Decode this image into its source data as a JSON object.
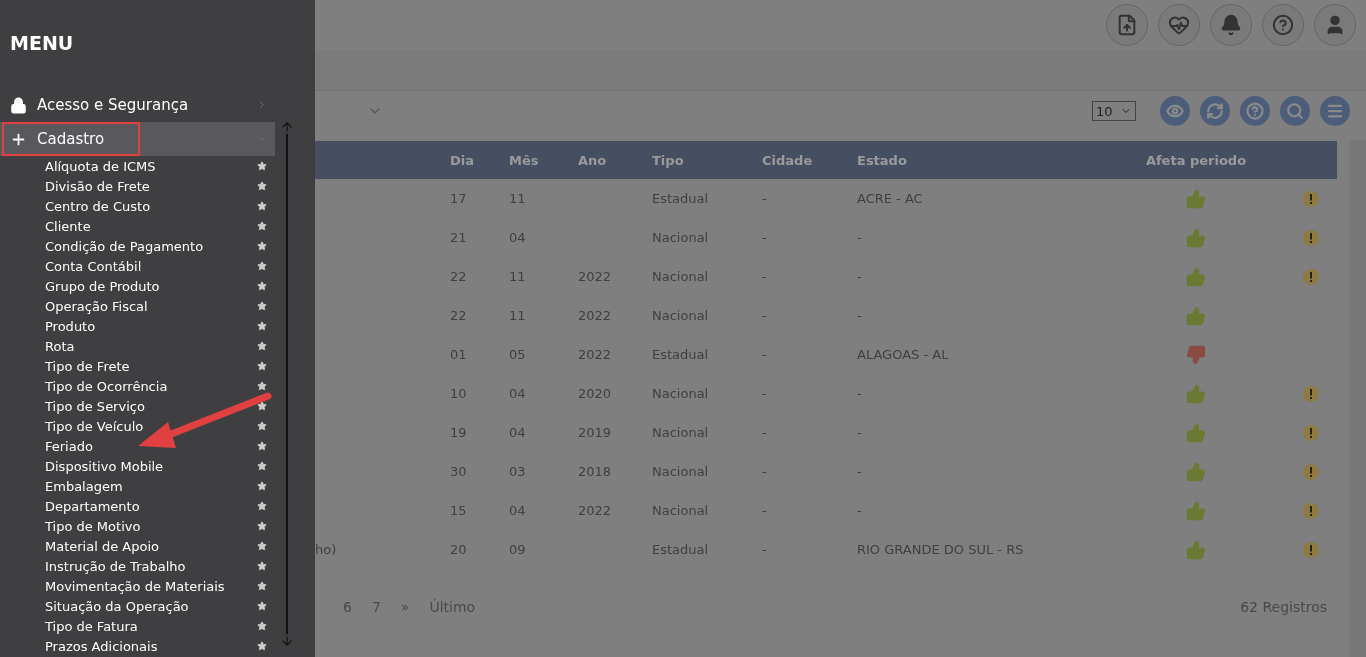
{
  "menu": {
    "title": "MENU",
    "sections": [
      {
        "label": "Acesso e Segurança",
        "kind": "lock",
        "expanded": false,
        "selected": false
      },
      {
        "label": "Cadastro",
        "kind": "plus",
        "expanded": true,
        "selected": true,
        "children": [
          {
            "label": "Alíquota de ICMS"
          },
          {
            "label": "Divisão de Frete"
          },
          {
            "label": "Centro de Custo"
          },
          {
            "label": "Cliente"
          },
          {
            "label": "Condição de Pagamento"
          },
          {
            "label": "Conta Contábil"
          },
          {
            "label": "Grupo de Produto"
          },
          {
            "label": "Operação Fiscal"
          },
          {
            "label": "Produto"
          },
          {
            "label": "Rota"
          },
          {
            "label": "Tipo de Frete"
          },
          {
            "label": "Tipo de Ocorrência"
          },
          {
            "label": "Tipo de Serviço"
          },
          {
            "label": "Tipo de Veículo"
          },
          {
            "label": "Feriado"
          },
          {
            "label": "Dispositivo Mobile"
          },
          {
            "label": "Embalagem"
          },
          {
            "label": "Departamento"
          },
          {
            "label": "Tipo de Motivo"
          },
          {
            "label": "Material de Apoio"
          },
          {
            "label": "Instrução de Trabalho"
          },
          {
            "label": "Movimentação de Materiais"
          },
          {
            "label": "Situação da Operação"
          },
          {
            "label": "Tipo de Fatura"
          },
          {
            "label": "Prazos Adicionais"
          }
        ]
      }
    ]
  },
  "top_bar": {
    "icons": [
      {
        "kind": "upload"
      },
      {
        "kind": "health"
      },
      {
        "kind": "bell"
      },
      {
        "kind": "help"
      },
      {
        "kind": "user"
      }
    ]
  },
  "toolbar": {
    "page_size": "10",
    "buttons": [
      {
        "kind": "view"
      },
      {
        "kind": "refresh"
      },
      {
        "kind": "help"
      },
      {
        "kind": "search"
      },
      {
        "kind": "menu"
      }
    ]
  },
  "table": {
    "columns": [
      "Dia",
      "Mês",
      "Ano",
      "Tipo",
      "Cidade",
      "Estado",
      "Afeta periodo"
    ],
    "rows": [
      {
        "dia": "17",
        "mes": "11",
        "tipo": "Estadual",
        "cidade": "-",
        "estado": "ACRE - AC",
        "affects": true,
        "warning": true
      },
      {
        "dia": "21",
        "mes": "04",
        "tipo": "Nacional",
        "cidade": "-",
        "estado": "-",
        "affects": true,
        "warning": true
      },
      {
        "dia": "22",
        "mes": "11",
        "ano": "2022",
        "tipo": "Nacional",
        "cidade": "-",
        "estado": "-",
        "affects": true,
        "warning": true
      },
      {
        "dia": "22",
        "mes": "11",
        "ano": "2022",
        "tipo": "Nacional",
        "cidade": "-",
        "estado": "-",
        "affects": true,
        "warning": false
      },
      {
        "dia": "01",
        "mes": "05",
        "ano": "2022",
        "tipo": "Estadual",
        "cidade": "-",
        "estado": "ALAGOAS - AL",
        "affects": false,
        "warning": false
      },
      {
        "dia": "10",
        "mes": "04",
        "ano": "2020",
        "tipo": "Nacional",
        "cidade": "-",
        "estado": "-",
        "affects": true,
        "warning": true
      },
      {
        "dia": "19",
        "mes": "04",
        "ano": "2019",
        "tipo": "Nacional",
        "cidade": "-",
        "estado": "-",
        "affects": true,
        "warning": true
      },
      {
        "dia": "30",
        "mes": "03",
        "ano": "2018",
        "tipo": "Nacional",
        "cidade": "-",
        "estado": "-",
        "affects": true,
        "warning": true
      },
      {
        "dia": "15",
        "mes": "04",
        "ano": "2022",
        "tipo": "Nacional",
        "cidade": "-",
        "estado": "-",
        "affects": true,
        "warning": true
      },
      {
        "name": "ho)",
        "dia": "20",
        "mes": "09",
        "tipo": "Estadual",
        "cidade": "-",
        "estado": "RIO GRANDE DO SUL - RS",
        "affects": true,
        "warning": true
      }
    ]
  },
  "pagination": {
    "pages": [
      "6",
      "7",
      "»",
      "Último"
    ],
    "total": "62 Registros"
  }
}
